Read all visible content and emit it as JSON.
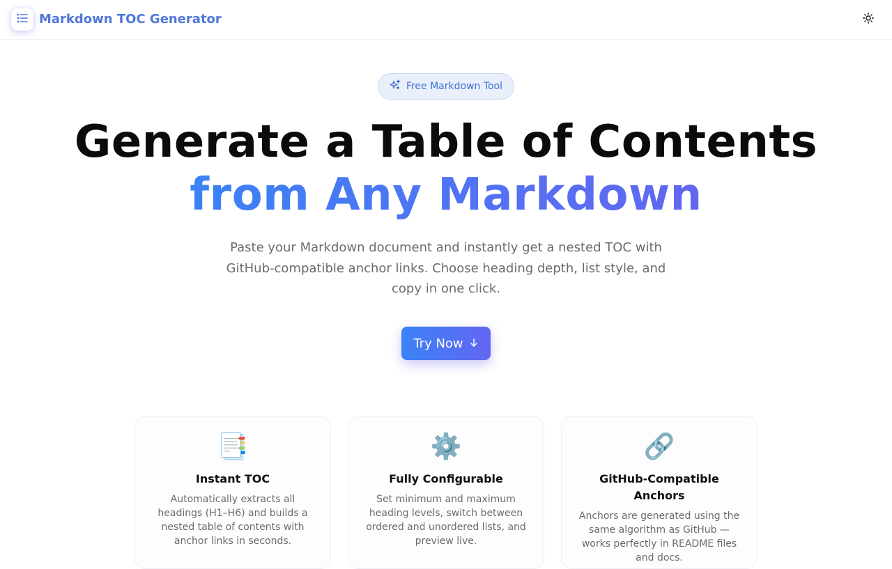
{
  "header": {
    "brand": "Markdown TOC Generator",
    "logo_icon": "list-icon",
    "theme_icon": "sun-icon",
    "brand_color": "#4f77d9"
  },
  "hero": {
    "badge_icon": "sparkles-icon",
    "badge": "Free Markdown Tool",
    "title_line1": "Generate a Table of Contents",
    "title_line2": "from Any Markdown",
    "subtitle": "Paste your Markdown document and instantly get a nested TOC with GitHub-compatible anchor links. Choose heading depth, list style, and copy in one click.",
    "cta_label": "Try Now",
    "cta_icon": "arrow-down-icon",
    "accent_gradient": [
      "#3b82f6",
      "#6366f1"
    ]
  },
  "features": [
    {
      "icon": "📑",
      "icon_name": "bookmark-tabs-icon",
      "title": "Instant TOC",
      "description": "Automatically extracts all headings (H1–H6) and builds a nested table of contents with anchor links in seconds."
    },
    {
      "icon": "⚙️",
      "icon_name": "gear-icon",
      "title": "Fully Configurable",
      "description": "Set minimum and maximum heading levels, switch between ordered and unordered lists, and preview live."
    },
    {
      "icon": "🔗",
      "icon_name": "link-icon",
      "title": "GitHub-Compatible Anchors",
      "description": "Anchors are generated using the same algorithm as GitHub — works perfectly in README files and docs."
    }
  ]
}
